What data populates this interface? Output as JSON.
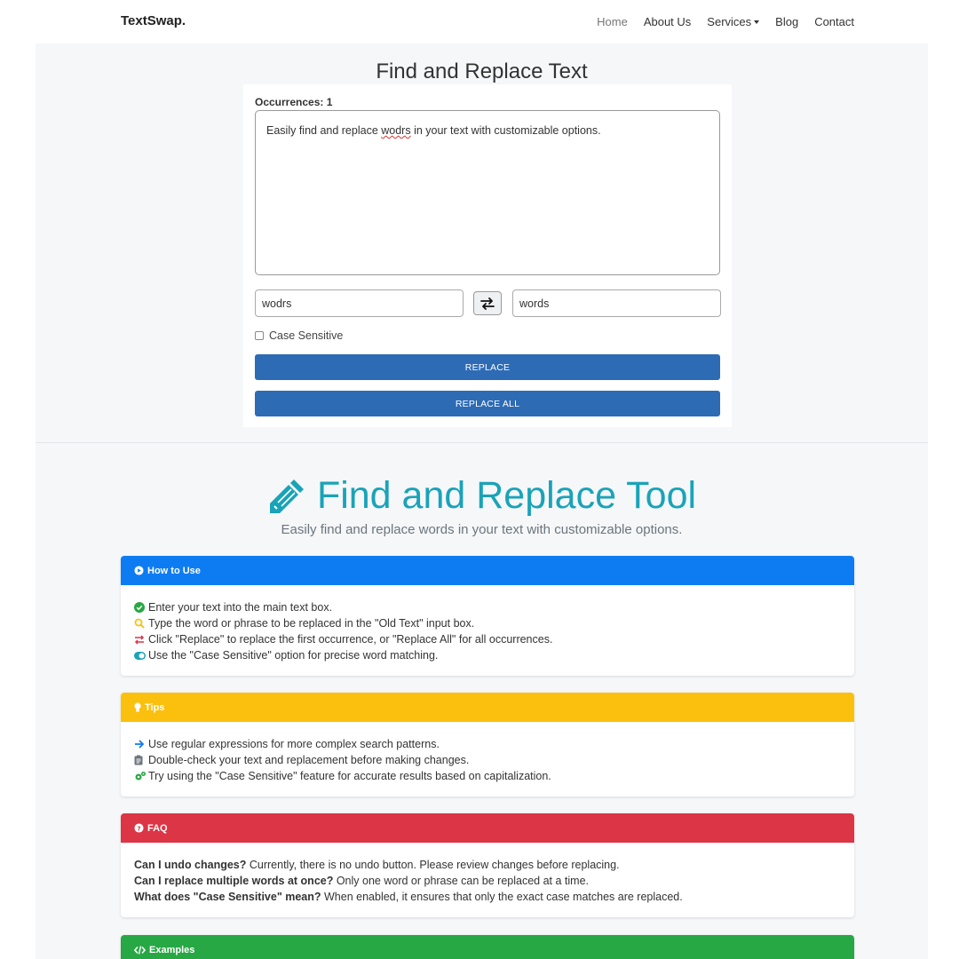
{
  "nav": {
    "brand": "TextSwap.",
    "items": [
      {
        "label": "Home",
        "active": true
      },
      {
        "label": "About Us"
      },
      {
        "label": "Services",
        "dropdown": true
      },
      {
        "label": "Blog"
      },
      {
        "label": "Contact"
      }
    ]
  },
  "tool": {
    "title": "Find and Replace Text",
    "occurrences": "Occurrences: 1",
    "text_before": "Easily find and replace ",
    "text_misspelled": "wodrs",
    "text_after": " in your text with customizable options.",
    "old_value": "wodrs",
    "new_value": "words",
    "case_sensitive_label": "Case Sensitive",
    "replace_label": "REPLACE",
    "replace_all_label": "REPLACE ALL"
  },
  "hero": {
    "title": "Find and Replace Tool",
    "subtitle": "Easily find and replace words in your text with customizable options."
  },
  "how": {
    "title": "How to Use",
    "items": [
      "Enter your text into the main text box.",
      "Type the word or phrase to be replaced in the \"Old Text\" input box.",
      "Click \"Replace\" to replace the first occurrence, or \"Replace All\" for all occurrences.",
      "Use the \"Case Sensitive\" option for precise word matching."
    ]
  },
  "tips": {
    "title": "Tips",
    "items": [
      "Use regular expressions for more complex search patterns.",
      "Double-check your text and replacement before making changes.",
      "Try using the \"Case Sensitive\" feature for accurate results based on capitalization."
    ]
  },
  "faq": {
    "title": "FAQ",
    "items": [
      {
        "q": "Can I undo changes?",
        "a": " Currently, there is no undo button. Please review changes before replacing."
      },
      {
        "q": "Can I replace multiple words at once?",
        "a": " Only one word or phrase can be replaced at a time."
      },
      {
        "q": "What does \"Case Sensitive\" mean?",
        "a": " When enabled, it ensures that only the exact case matches are replaced."
      }
    ]
  },
  "examples": {
    "title": "Examples"
  },
  "colors": {
    "primary_button": "#2d6bb5",
    "hero_title": "#1aa3b8",
    "how_header": "#0d7cf2",
    "tips_header": "#fbbf0e",
    "faq_header": "#dc3545",
    "examples_header": "#28a745"
  }
}
